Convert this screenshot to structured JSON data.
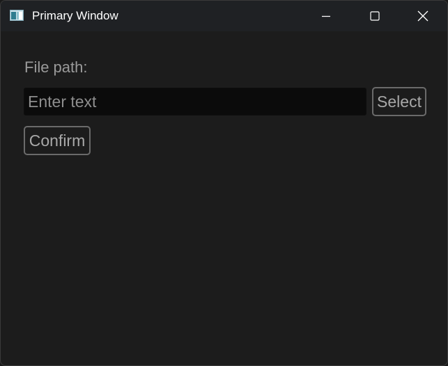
{
  "window": {
    "title": "Primary Window",
    "app_icon": "app-window-icon",
    "controls": {
      "minimize": "minimize-icon",
      "maximize": "maximize-icon",
      "close": "close-icon"
    }
  },
  "form": {
    "path_label": "File path:",
    "path_input": {
      "value": "",
      "placeholder": "Enter text"
    },
    "select_label": "Select",
    "confirm_label": "Confirm"
  },
  "colors": {
    "window_bg": "#1c1c1c",
    "titlebar_bg": "#1f2124",
    "input_bg": "#0b0b0b",
    "button_border": "#6a6a6a",
    "label_text": "#9a9a9a"
  }
}
